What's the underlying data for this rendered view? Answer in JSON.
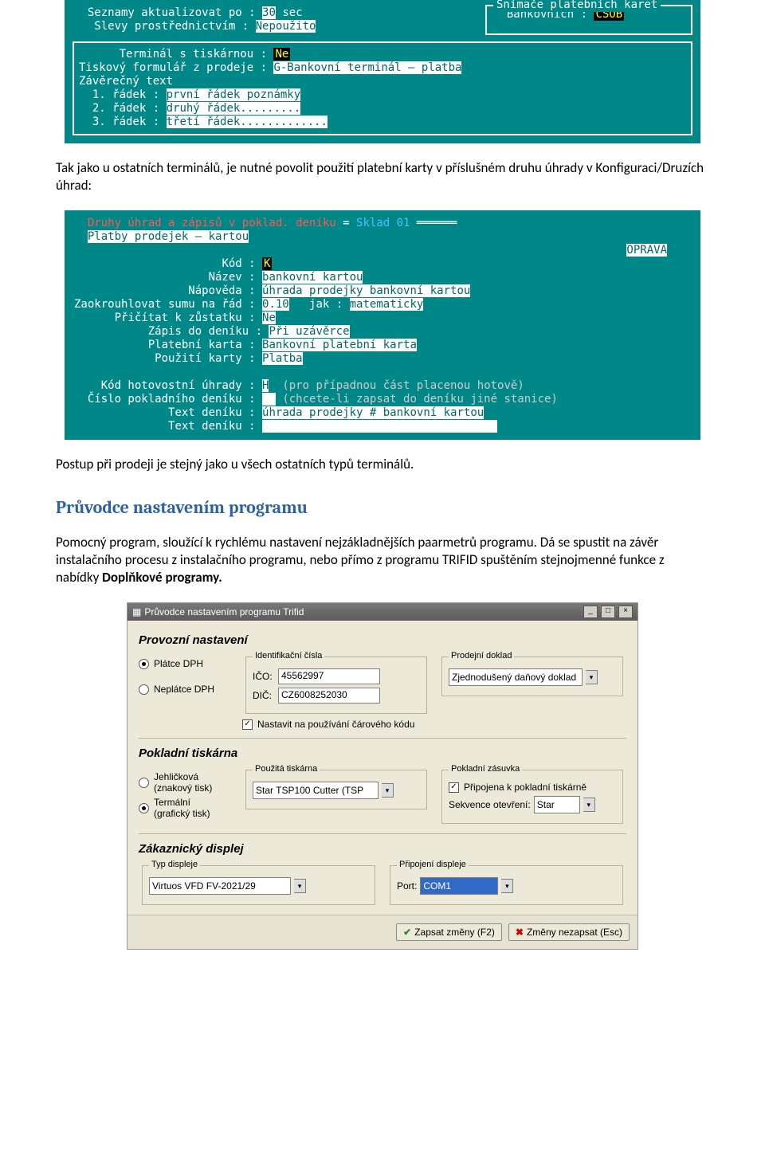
{
  "term1": {
    "update_after_label": "Seznamy aktualizovat po :",
    "update_after_value": "30",
    "update_after_unit": "sec",
    "discounts_label": "Slevy prostřednictvím :",
    "discounts_value": "Nepoužito",
    "readers_title": "Snímače platebních karet",
    "bank_label": "Bankovních :",
    "bank_value": "ČSOB",
    "printer_label": "Terminál s tiskárnou :",
    "printer_value": "Ne",
    "form_label": "Tiskový formulář z prodeje :",
    "form_value": "G-Bankovní terminál – platba",
    "footer_title": "Závěrečný text",
    "r1_label": "1. řádek :",
    "r1_value": "první řádek poznámky",
    "r2_label": "2. řádek :",
    "r2_value": "druhý řádek.........",
    "r3_label": "3. řádek :",
    "r3_value": "třetí řádek............."
  },
  "p1": "Tak jako u ostatních terminálů, je nutné povolit použití platební karty v příslušném druhu úhrady v Konfiguraci/Druzích úhrad:",
  "term2": {
    "header": "Druhy úhrad a zápisů v poklad. deníku",
    "header_eq": "= ",
    "header_sklad": "Sklad 01",
    "subheader": "Platby prodejek – kartou",
    "oprava": "OPRAVA",
    "kod_label": "Kód :",
    "kod_value": "K",
    "nazev_label": "Název :",
    "nazev_value": "bankovní kartou",
    "napoveda_label": "Nápověda :",
    "napoveda_value": "úhrada prodejky bankovní kartou",
    "zaokr_label": "Zaokrouhlovat sumu na řád :",
    "zaokr_value": "0.10",
    "jak_label": "jak :",
    "jak_value": "matematicky",
    "pricitat_label": "Přičítat k zůstatku :",
    "pricitat_value": "Ne",
    "zapis_label": "Zápis do deníku :",
    "zapis_value": "Při uzávěrce",
    "karta_label": "Platební karta :",
    "karta_value": "Bankovní platební karta",
    "pouziti_label": "Použití karty :",
    "pouziti_value": "Platba",
    "hot_label": "Kód hotovostní úhrady :",
    "hot_value": "H",
    "hot_hint": "(pro případnou část placenou hotově)",
    "cislo_label": "Číslo pokladního deníku :",
    "cislo_hint": "(chcete-li zapsat do deníku jiné stanice)",
    "text1_label": "Text deníku :",
    "text1_value": "úhrada prodejky # bankovní kartou",
    "text2_label": "Text deníku :"
  },
  "p2": "Postup při prodeji je stejný jako u všech ostatních typů terminálů.",
  "h2": "Průvodce nastavením programu",
  "p3": "Pomocný program, sloužící k rychlému nastavení nejzákladnějších paarmetrů programu. Dá se spustit na závěr instalačního procesu z instalačního programu, nebo přímo z programu TRIFID spuštěním stejnojmenné funkce z nabídky ",
  "p3b": "Doplňkové programy.",
  "wiz": {
    "title": "Průvodce nastavením programu Trifid",
    "s1": "Provozní nastavení",
    "dph1": "Plátce DPH",
    "dph2": "Neplátce DPH",
    "id_group": "Identifikační čísla",
    "ico_l": "IČO:",
    "ico_v": "45562997",
    "dic_l": "DIČ:",
    "dic_v": "CZ6008252030",
    "doc_group": "Prodejní doklad",
    "doc_v": "Zjednodušený daňový doklad",
    "barcode": "Nastavit na používání čárového kódu",
    "s2": "Pokladní tiskárna",
    "pr_r1": "Jehličková\n(znakový tisk)",
    "pr_r2": "Termální\n(grafický tisk)",
    "pr_group": "Použitá tiskárna",
    "pr_v": "Star TSP100 Cutter (TSP",
    "drawer_group": "Pokladní zásuvka",
    "drawer_chk": "Připojena k pokladní tiskárně",
    "seq_l": "Sekvence otevření:",
    "seq_v": "Star",
    "s3": "Zákaznický displej",
    "disp_group": "Typ displeje",
    "disp_v": "Virtuos VFD FV-2021/29",
    "conn_group": "Připojení displeje",
    "port_l": "Port:",
    "port_v": "COM1",
    "btn_ok": "Zapsat změny (F2)",
    "btn_cancel": "Změny nezapsat (Esc)"
  }
}
